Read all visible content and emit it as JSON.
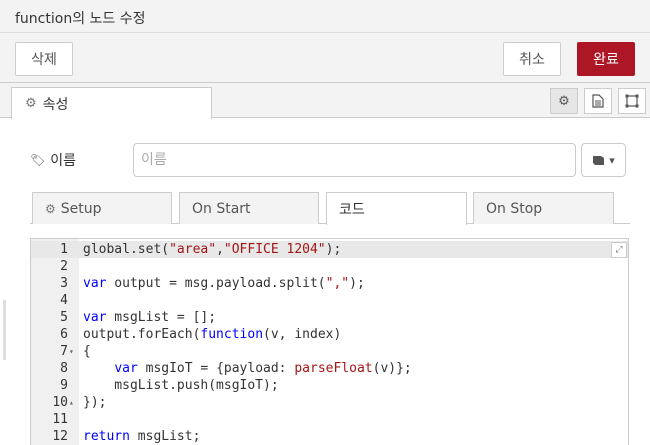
{
  "dialog": {
    "title": "function의 노드 수정"
  },
  "buttons": {
    "delete": "삭제",
    "cancel": "취소",
    "done": "완료"
  },
  "tabs": {
    "properties": "속성"
  },
  "name_field": {
    "label": "이름",
    "placeholder": "이름"
  },
  "sub_tabs": [
    "Setup",
    "On Start",
    "코드",
    "On Stop"
  ],
  "code_lines": [
    {
      "n": "1",
      "fold": ""
    },
    {
      "n": "2",
      "fold": ""
    },
    {
      "n": "3",
      "fold": ""
    },
    {
      "n": "4",
      "fold": ""
    },
    {
      "n": "5",
      "fold": ""
    },
    {
      "n": "6",
      "fold": ""
    },
    {
      "n": "7",
      "fold": "▾"
    },
    {
      "n": "8",
      "fold": ""
    },
    {
      "n": "9",
      "fold": ""
    },
    {
      "n": "10",
      "fold": "▴"
    },
    {
      "n": "11",
      "fold": ""
    },
    {
      "n": "12",
      "fold": ""
    }
  ],
  "code_text": [
    "global.set(\"area\",\"OFFICE 1204\");",
    "",
    "var output = msg.payload.split(\",\");",
    "",
    "var msgList = [];",
    "output.forEach(function(v, index)",
    "{",
    "    var msgIoT = {payload: parseFloat(v)};",
    "    msgList.push(msgIoT);",
    "});",
    "",
    "return msgList;"
  ],
  "colors": {
    "done_button": "#ad1625",
    "keyword": "#0000ff",
    "string": "#a31515"
  },
  "icons": [
    "gear-icon",
    "document-icon",
    "frame-icon",
    "tag-icon",
    "book-icon",
    "expand-icon"
  ]
}
